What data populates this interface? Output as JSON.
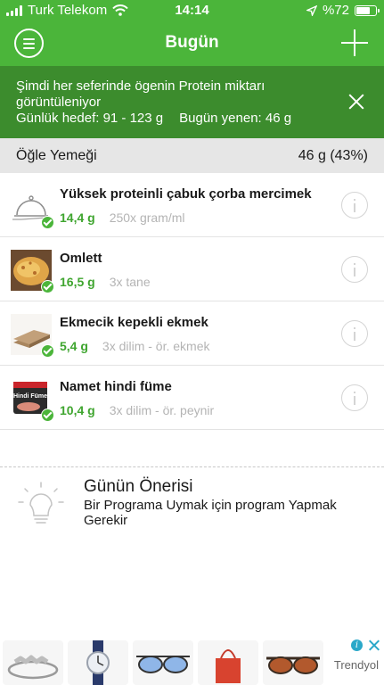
{
  "status_bar": {
    "carrier": "Turk Telekom",
    "time": "14:14",
    "battery": "%72",
    "battery_level": 0.72
  },
  "header": {
    "title": "Bugün",
    "menu_icon": "hamburger-menu-icon",
    "add_icon": "plus-icon"
  },
  "notice": {
    "message": "Şimdi her seferinde ögenin Protein miktarı görüntüleniyor",
    "goal": "Günlük hedef: 91 - 123 g",
    "eaten": "Bugün yenen: 46 g",
    "close_icon": "close-icon"
  },
  "meal": {
    "name": "Öğle Yemeği",
    "total": "46 g (43%)"
  },
  "items": [
    {
      "name": "Yüksek proteinli çabuk çorba mercimek",
      "amount": "14,4 g",
      "portion": "250x gram/ml",
      "icon": "cloche-icon"
    },
    {
      "name": "Omlett",
      "amount": "16,5 g",
      "portion": "3x tane",
      "icon": "omelette-photo-icon"
    },
    {
      "name": "Ekmecik kepekli ekmek",
      "amount": "5,4 g",
      "portion": "3x dilim - ör. ekmek",
      "icon": "bread-photo-icon"
    },
    {
      "name": "Namet hindi füme",
      "amount": "10,4 g",
      "portion": "3x dilim - ör. peynir",
      "icon": "turkey-pack-photo-icon",
      "pack_label": "Hindi Füme"
    }
  ],
  "tip": {
    "title": "Günün Önerisi",
    "text": "Bir Programa Uymak için program Yapmak Gerekir",
    "icon": "lightbulb-icon"
  },
  "ad": {
    "brand": "Trendyol",
    "products": [
      "ring-icon",
      "watch-icon",
      "sunglasses-icon",
      "tote-bag-icon",
      "sunglasses-icon"
    ]
  },
  "colors": {
    "brand_green": "#4bb53a",
    "banner_green": "#3c8c2d",
    "amount_green": "#3fa52f"
  }
}
